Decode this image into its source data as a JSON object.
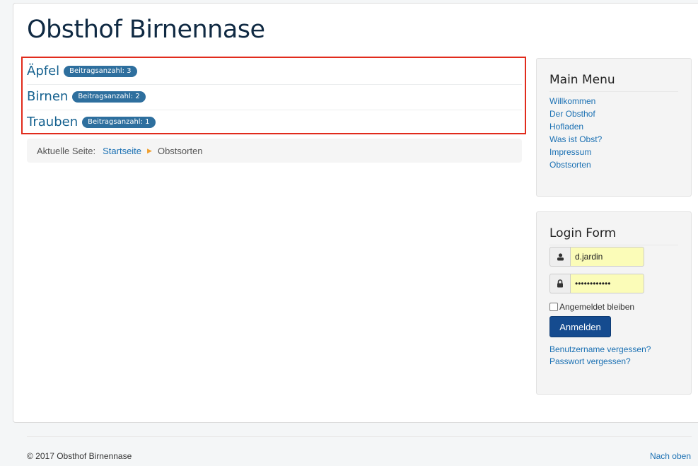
{
  "site": {
    "title": "Obsthof Birnennase"
  },
  "categories": [
    {
      "name": "Äpfel",
      "badge": "Beitragsanzahl: 3"
    },
    {
      "name": "Birnen",
      "badge": "Beitragsanzahl: 2"
    },
    {
      "name": "Trauben",
      "badge": "Beitragsanzahl: 1"
    }
  ],
  "breadcrumb": {
    "label": "Aktuelle Seite:",
    "home": "Startseite",
    "current": "Obstsorten"
  },
  "main_menu": {
    "title": "Main Menu",
    "items": [
      "Willkommen",
      "Der Obsthof",
      "Hofladen",
      "Was ist Obst?",
      "Impressum",
      "Obstsorten"
    ]
  },
  "login": {
    "title": "Login Form",
    "username": "d.jardin",
    "password": "••••••••••••",
    "remember": "Angemeldet bleiben",
    "submit": "Anmelden",
    "forgot_user": "Benutzername vergessen?",
    "forgot_pass": "Passwort vergessen?"
  },
  "footer": {
    "copyright": "© 2017 Obsthof Birnennase",
    "back_to_top": "Nach oben"
  },
  "colors": {
    "link": "#1a70b3",
    "badge": "#2e6f9e",
    "highlight_border": "#e12b1c",
    "button": "#154b8f"
  }
}
